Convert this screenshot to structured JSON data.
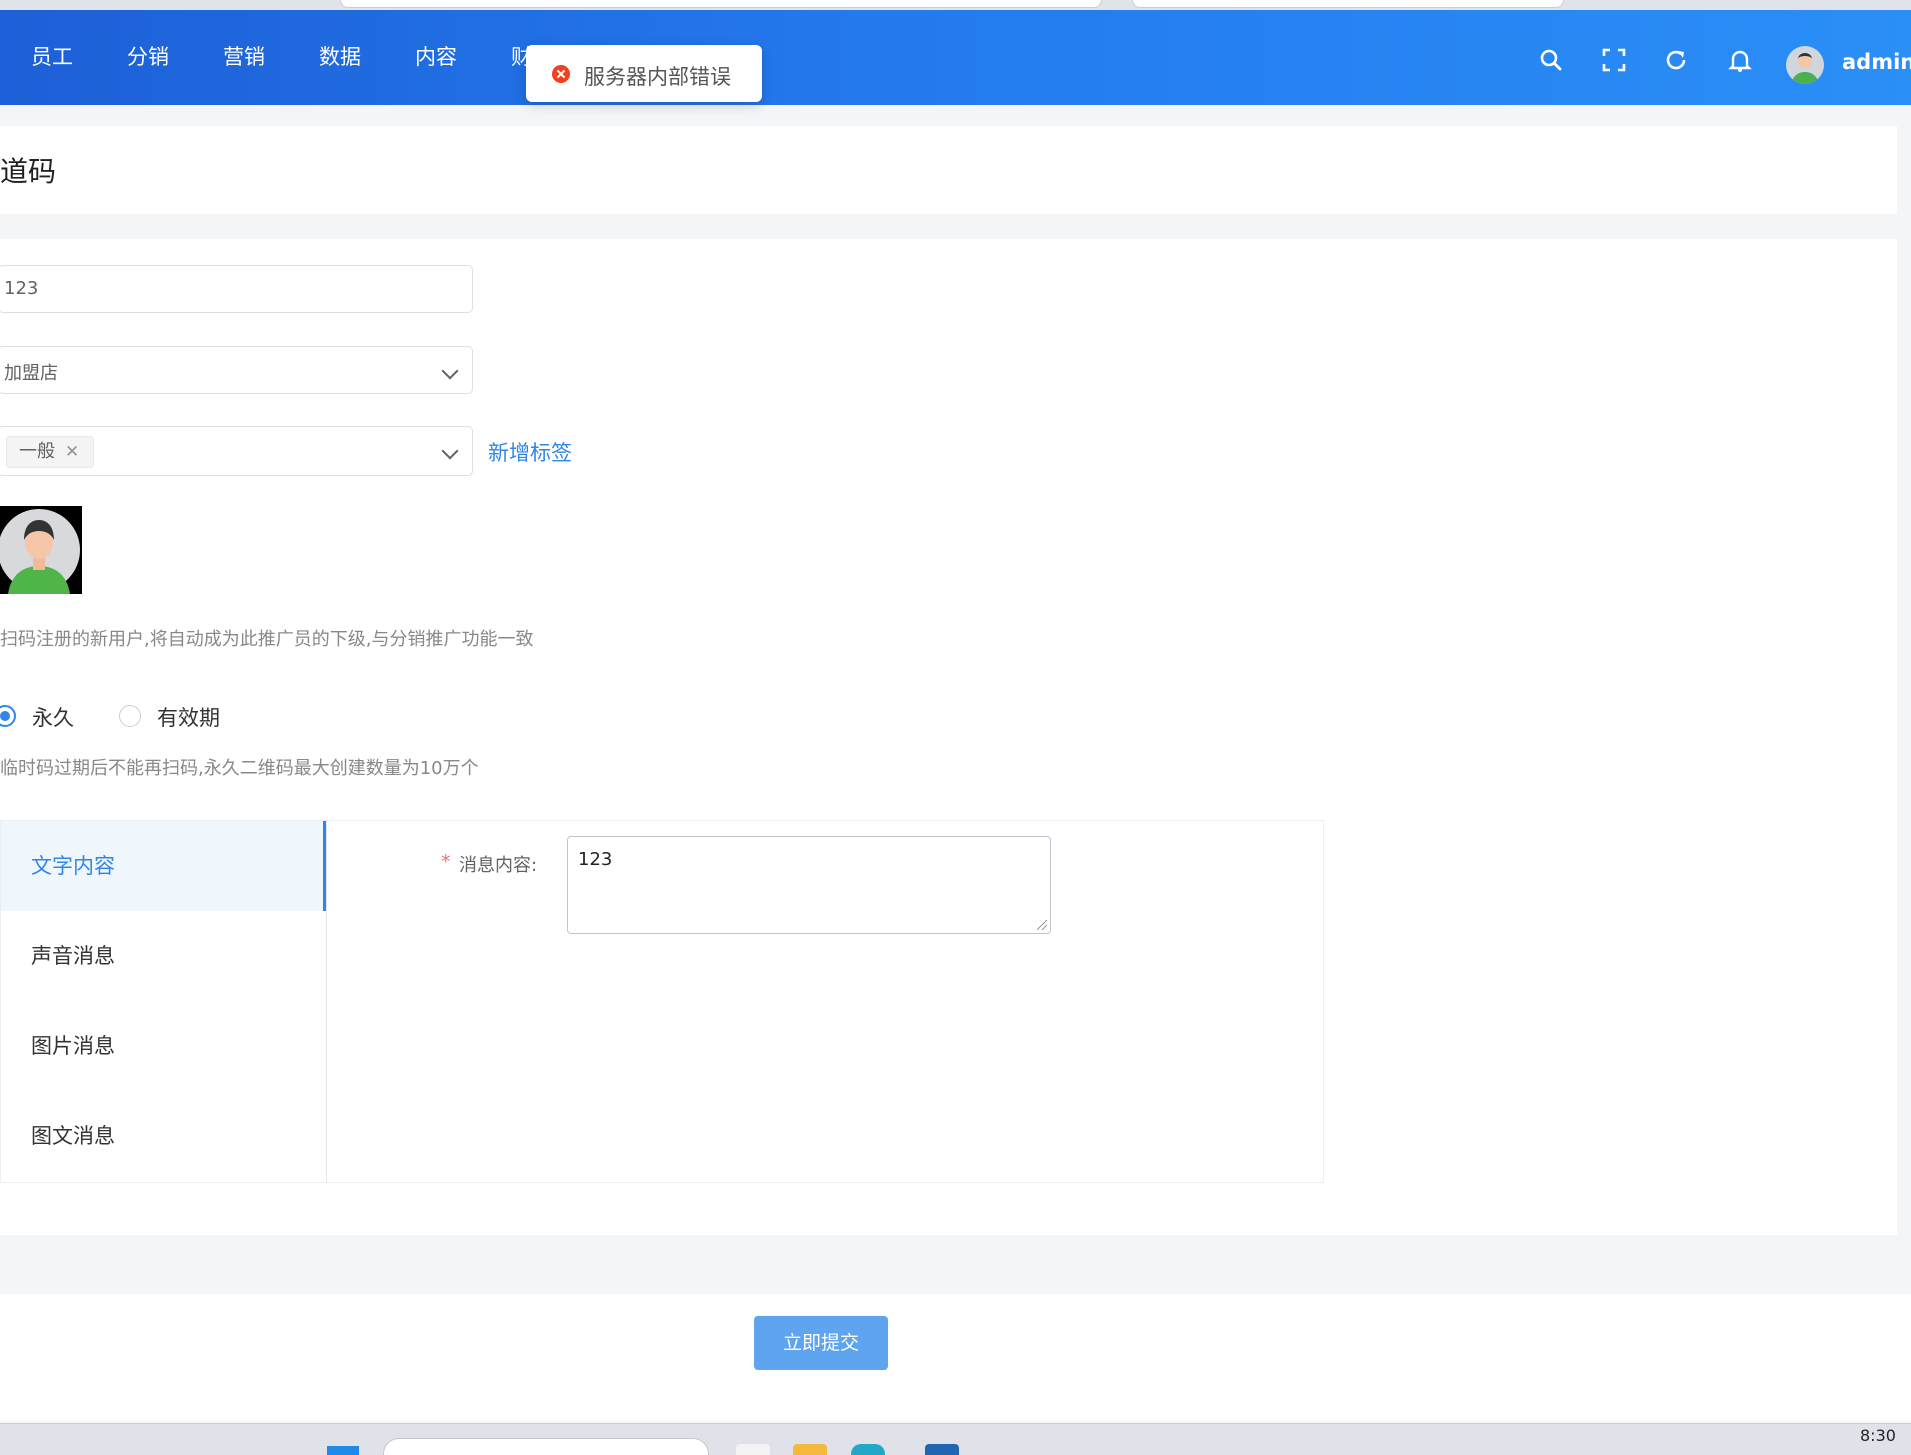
{
  "nav": {
    "items": [
      "员工",
      "分销",
      "营销",
      "数据",
      "内容",
      "财"
    ]
  },
  "header": {
    "icons": [
      "search-icon",
      "fullscreen-icon",
      "refresh-icon",
      "bell-icon"
    ],
    "user": "admin"
  },
  "toast": {
    "message": "服务器内部错误",
    "type": "error"
  },
  "page": {
    "title": "道码"
  },
  "form": {
    "name_value": "123",
    "group_value": "加盟店",
    "tag_value": "一般",
    "add_tag_label": "新增标签",
    "avatar_hint": "扫码注册的新用户,将自动成为此推广员的下级,与分销推广功能一致",
    "validity": {
      "options": [
        "永久",
        "有效期"
      ],
      "selected": "永久"
    },
    "validity_hint": "临时码过期后不能再扫码,永久二维码最大创建数量为10万个",
    "message_tabs": [
      "文字内容",
      "声音消息",
      "图片消息",
      "图文消息"
    ],
    "active_tab": "文字内容",
    "message_label": "消息内容:",
    "message_required_mark": "*",
    "message_value": "123"
  },
  "footer": {
    "submit_label": "立即提交"
  },
  "taskbar": {
    "clock": "8:30"
  },
  "colors": {
    "primary": "#2f86e8",
    "header_start": "#1d5fd6",
    "header_end": "#2a8ff7",
    "error": "#f0401f",
    "submit": "#5ea4ee"
  }
}
